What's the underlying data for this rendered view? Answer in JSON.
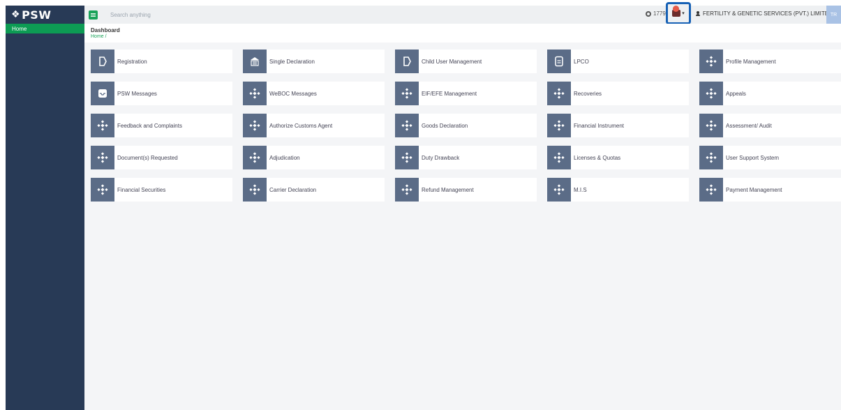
{
  "brand": {
    "logo_text": "PSW"
  },
  "sidebar": {
    "items": [
      {
        "label": "Home"
      }
    ]
  },
  "topbar": {
    "search_placeholder": "Search anything",
    "credits": "1779",
    "user_name": "FERTILITY & GENETIC SERVICES (PVT.) LIMITED",
    "avatar_initials": "TR"
  },
  "page": {
    "title": "Dashboard",
    "breadcrumb": "Home /"
  },
  "tiles": [
    {
      "label": "Registration",
      "icon": "tag-icon"
    },
    {
      "label": "Single Declaration",
      "icon": "building-icon"
    },
    {
      "label": "Child User Management",
      "icon": "tag-icon"
    },
    {
      "label": "LPCO",
      "icon": "document-icon"
    },
    {
      "label": "Profile Management",
      "icon": "diamond-icon"
    },
    {
      "label": "PSW Messages",
      "icon": "inbox-icon"
    },
    {
      "label": "WeBOC Messages",
      "icon": "diamond-icon"
    },
    {
      "label": "EIF/EFE Management",
      "icon": "diamond-icon"
    },
    {
      "label": "Recoveries",
      "icon": "diamond-icon"
    },
    {
      "label": "Appeals",
      "icon": "diamond-icon"
    },
    {
      "label": "Feedback and Complaints",
      "icon": "diamond-icon"
    },
    {
      "label": "Authorize Customs Agent",
      "icon": "diamond-icon"
    },
    {
      "label": "Goods Declaration",
      "icon": "diamond-icon"
    },
    {
      "label": "Financial Instrument",
      "icon": "diamond-icon"
    },
    {
      "label": "Assessment/ Audit",
      "icon": "diamond-icon"
    },
    {
      "label": "Document(s) Requested",
      "icon": "diamond-icon"
    },
    {
      "label": "Adjudication",
      "icon": "diamond-icon"
    },
    {
      "label": "Duty Drawback",
      "icon": "diamond-icon"
    },
    {
      "label": "Licenses & Quotas",
      "icon": "diamond-icon"
    },
    {
      "label": "User Support System",
      "icon": "diamond-icon"
    },
    {
      "label": "Financial Securities",
      "icon": "diamond-icon"
    },
    {
      "label": "Carrier Declaration",
      "icon": "diamond-icon"
    },
    {
      "label": "Refund Management",
      "icon": "diamond-icon"
    },
    {
      "label": "M.I.S",
      "icon": "diamond-icon"
    },
    {
      "label": "Payment Management",
      "icon": "diamond-icon"
    }
  ],
  "colors": {
    "sidebar": "#283a56",
    "accent": "#1aa35a",
    "tile_icon_bg": "#5b6c87",
    "highlight": "#1761b5"
  }
}
